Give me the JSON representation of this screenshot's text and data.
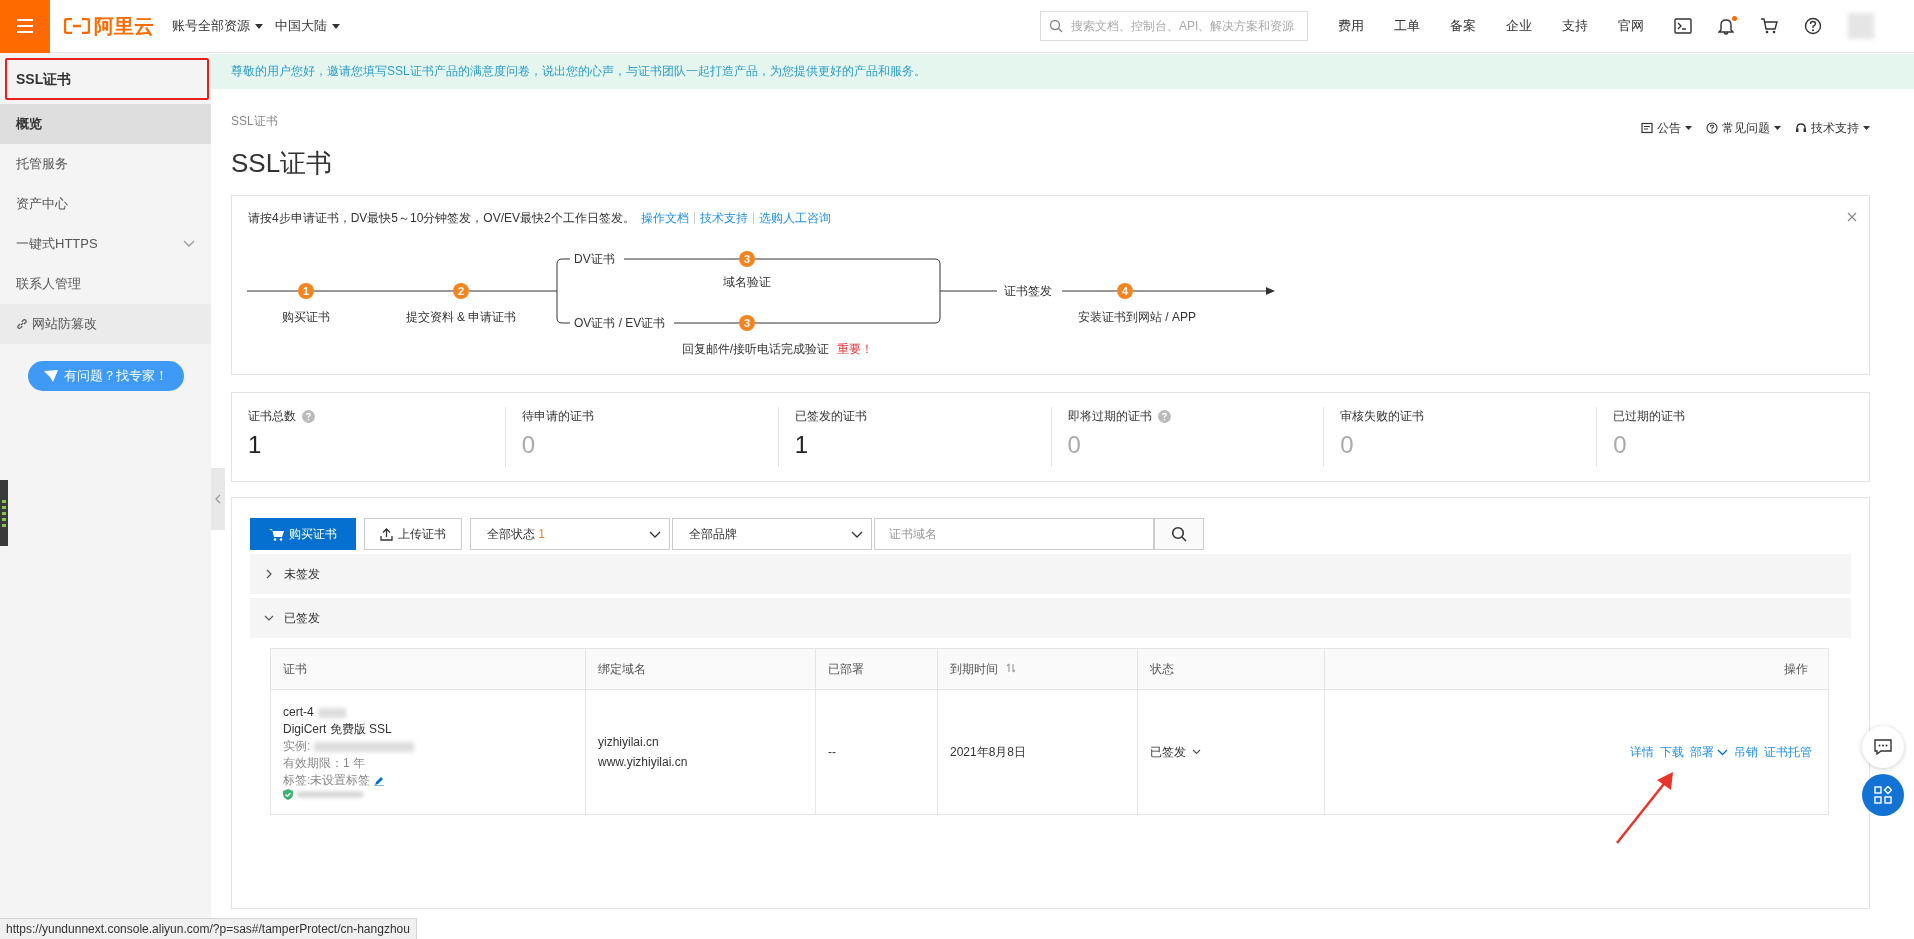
{
  "topbar": {
    "logo": "阿里云",
    "menus": [
      {
        "label": "账号全部资源"
      },
      {
        "label": "中国大陆"
      }
    ],
    "search": {
      "placeholder": "搜索文档、控制台、API、解决方案和资源"
    },
    "links": [
      "费用",
      "工单",
      "备案",
      "企业",
      "支持",
      "官网"
    ],
    "has_unread": true
  },
  "sidebar": {
    "title": "SSL证书",
    "items": [
      {
        "label": "概览",
        "kind": "item",
        "selected": true
      },
      {
        "label": "托管服务",
        "kind": "item",
        "selected": false
      },
      {
        "label": "资产中心",
        "kind": "item",
        "selected": false
      },
      {
        "label": "一键式HTTPS",
        "kind": "group",
        "selected": false,
        "expanded": false
      },
      {
        "label": "联系人管理",
        "kind": "item",
        "selected": false
      },
      {
        "label": "网站防篡改",
        "kind": "external",
        "selected": false
      }
    ],
    "help_button": "有问题？找专家！"
  },
  "notice": "尊敬的用户您好，邀请您填写SSL证书产品的满意度问卷，说出您的心声，与证书团队一起打造产品，为您提供更好的产品和服务。",
  "breadcrumb": "SSL证书",
  "header_links": [
    {
      "label": "公告",
      "kind": "notice"
    },
    {
      "label": "常见问题",
      "kind": "faq"
    },
    {
      "label": "技术支持",
      "kind": "support"
    }
  ],
  "title": "SSL证书",
  "guide": {
    "intro": "请按4步申请证书，DV最快5～10分钟签发，OV/EV最快2个工作日签发。",
    "links": [
      "操作文档",
      "技术支持",
      "选购人工咨询"
    ],
    "steps": [
      {
        "number": "1",
        "label": "购买证书"
      },
      {
        "number": "2",
        "label": "提交资料 & 申请证书"
      }
    ],
    "branches": [
      {
        "label": "DV证书",
        "number": "3"
      },
      {
        "label": "OV证书 / EV证书",
        "number": "3"
      }
    ],
    "branch_label": "域名验证",
    "issue_label": "证书签发",
    "final": {
      "number": "4",
      "label": "安装证书到网站 / APP"
    },
    "note": "回复邮件/接听电话完成验证",
    "note_emphasis": "重要！"
  },
  "stats": [
    {
      "label": "证书总数",
      "help": true,
      "value": "1",
      "dimmed": false
    },
    {
      "label": "待申请的证书",
      "help": false,
      "value": "0",
      "dimmed": true
    },
    {
      "label": "已签发的证书",
      "help": false,
      "value": "1",
      "dimmed": false
    },
    {
      "label": "即将过期的证书",
      "help": true,
      "value": "0",
      "dimmed": true
    },
    {
      "label": "审核失败的证书",
      "help": false,
      "value": "0",
      "dimmed": true
    },
    {
      "label": "已过期的证书",
      "help": false,
      "value": "0",
      "dimmed": true
    }
  ],
  "toolbar": {
    "buy": "购买证书",
    "upload": "上传证书",
    "status_filter": {
      "value": "全部状态",
      "count": "1"
    },
    "brand_filter": {
      "value": "全部品牌"
    },
    "search": {
      "placeholder": "证书域名"
    }
  },
  "groups": [
    {
      "label": "未签发",
      "expanded": false
    },
    {
      "label": "已签发",
      "expanded": true
    }
  ],
  "table": {
    "columns": [
      {
        "label": "证书",
        "sortable": false
      },
      {
        "label": "绑定域名",
        "sortable": false
      },
      {
        "label": "已部署",
        "sortable": false
      },
      {
        "label": "到期时间",
        "sortable": true
      },
      {
        "label": "状态",
        "sortable": false
      },
      {
        "label": "操作",
        "sortable": false
      }
    ],
    "rows": [
      {
        "cert": {
          "id": "cert-4",
          "product": "DigiCert 免费版 SSL",
          "instance": "实例:",
          "validity": "有效期限：1 年",
          "tags": "标签:未设置标签"
        },
        "domains": [
          "yizhiyilai.cn",
          "www.yizhiyilai.cn"
        ],
        "deployed": "--",
        "expires": "2021年8月8日",
        "status": "已签发",
        "actions": [
          {
            "label": "详情",
            "kind": "link"
          },
          {
            "label": "下载",
            "kind": "link"
          },
          {
            "label": "部署",
            "kind": "menu"
          },
          {
            "label": "吊销",
            "kind": "link"
          },
          {
            "label": "证书托管",
            "kind": "link"
          }
        ]
      }
    ]
  },
  "status_url": "https://yundunnext.console.aliyun.com/?p=sas#/tamperProtect/cn-hangzhou"
}
